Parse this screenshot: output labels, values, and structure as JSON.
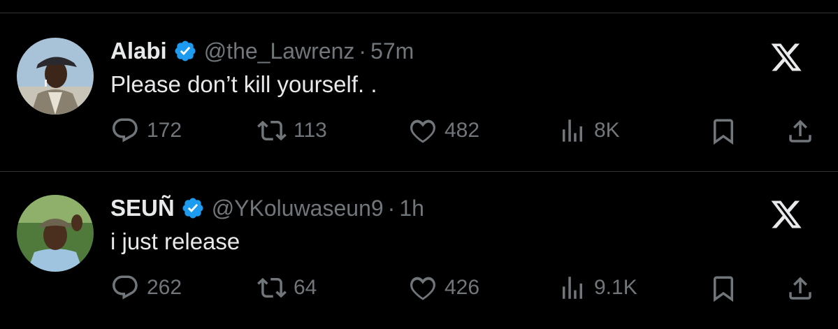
{
  "tweets": [
    {
      "name": "Alabi",
      "handle": "@the_Lawrenz",
      "separator": "·",
      "time": "57m",
      "text": "Please don’t kill yourself. .",
      "replies": "172",
      "retweets": "113",
      "likes": "482",
      "views": "8K"
    },
    {
      "name": "SEUÑ",
      "handle": "@YKoluwaseun9",
      "separator": "·",
      "time": "1h",
      "text": "i just release",
      "replies": "262",
      "retweets": "64",
      "likes": "426",
      "views": "9.1K"
    }
  ],
  "colors": {
    "background": "#000000",
    "primary_text": "#e7e9ea",
    "secondary_text": "#71767b",
    "verified": "#1d9bf0",
    "divider": "#2f3336"
  },
  "icons": [
    "reply-icon",
    "retweet-icon",
    "like-icon",
    "views-icon",
    "bookmark-icon",
    "share-icon",
    "verified-icon",
    "x-logo-icon"
  ]
}
